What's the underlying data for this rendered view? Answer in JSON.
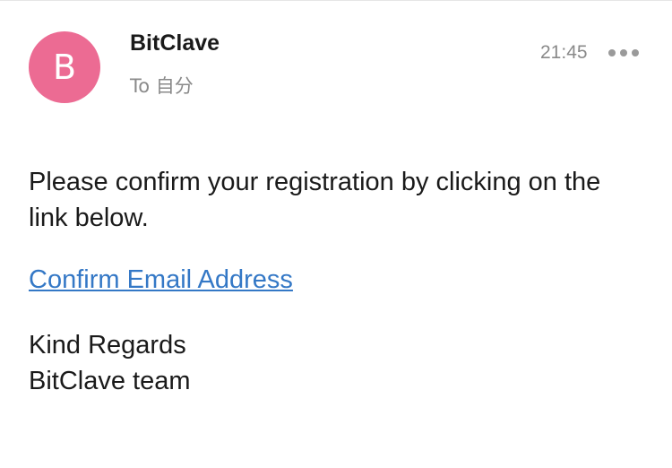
{
  "sender": {
    "avatar_letter": "B",
    "avatar_color": "#ec6b93",
    "name": "BitClave"
  },
  "recipient": {
    "line": "To 自分"
  },
  "time": "21:45",
  "more_icon": "more-horizontal-icon",
  "message": {
    "body": "Please confirm your registration by clicking on the link below.",
    "link_text": "Confirm Email Address",
    "link_color": "#3478c6",
    "signoff_line1": "Kind Regards",
    "signoff_line2": "BitClave team"
  }
}
